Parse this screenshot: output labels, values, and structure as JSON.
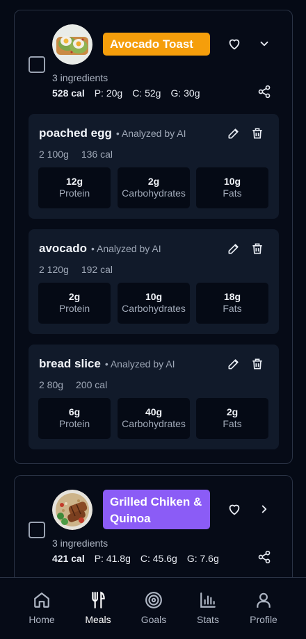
{
  "meals": [
    {
      "name": "Avocado Toast",
      "ingredient_count": "3 ingredients",
      "calories": "528 cal",
      "protein": "P: 20g",
      "carbs": "C: 52g",
      "fat": "G: 30g",
      "tag_color": "#f59e0b",
      "expanded": true,
      "ingredients": [
        {
          "name": "poached egg",
          "source": "• Analyzed by AI",
          "qty": "2 100g",
          "cal": "136 cal",
          "protein": "12g",
          "carbs": "2g",
          "fats": "10g"
        },
        {
          "name": "avocado",
          "source": "• Analyzed by AI",
          "qty": "2 120g",
          "cal": "192 cal",
          "protein": "2g",
          "carbs": "10g",
          "fats": "18g"
        },
        {
          "name": "bread slice",
          "source": "• Analyzed by AI",
          "qty": "2 80g",
          "cal": "200 cal",
          "protein": "6g",
          "carbs": "40g",
          "fats": "2g"
        }
      ]
    },
    {
      "name": "Grilled Chiken & Quinoa",
      "ingredient_count": "3 ingredients",
      "calories": "421 cal",
      "protein": "P: 41.8g",
      "carbs": "C: 45.6g",
      "fat": "G: 7.6g",
      "tag_color": "#8b5cf6",
      "expanded": false
    }
  ],
  "macro_labels": {
    "protein": "Protein",
    "carbs": "Carbohydrates",
    "fats": "Fats"
  },
  "nav": [
    {
      "label": "Home",
      "icon": "home-icon",
      "active": false
    },
    {
      "label": "Meals",
      "icon": "utensils-icon",
      "active": true
    },
    {
      "label": "Goals",
      "icon": "target-icon",
      "active": false
    },
    {
      "label": "Stats",
      "icon": "bar-chart-icon",
      "active": false
    },
    {
      "label": "Profile",
      "icon": "user-icon",
      "active": false
    }
  ]
}
